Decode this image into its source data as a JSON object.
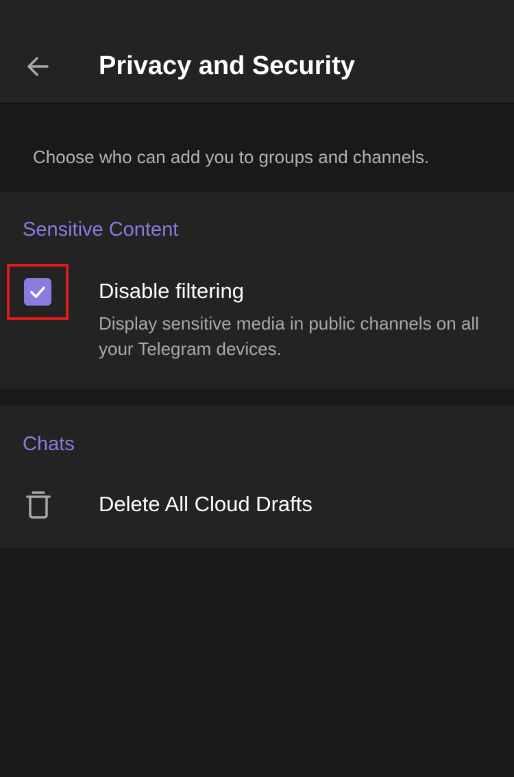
{
  "header": {
    "back_icon": "arrow-left-icon",
    "title": "Privacy and Security"
  },
  "info": {
    "text": "Choose who can add you to groups and channels."
  },
  "sensitive_content": {
    "header": "Sensitive Content",
    "disable_filtering": {
      "title": "Disable filtering",
      "subtitle": "Display sensitive media in public channels on all your Telegram devices.",
      "checked": true,
      "icon": "checkbox-icon"
    }
  },
  "chats": {
    "header": "Chats",
    "delete_drafts": {
      "title": "Delete All Cloud Drafts",
      "icon": "trash-icon"
    }
  },
  "colors": {
    "accent": "#8b7bde",
    "background": "#1b1b1b",
    "surface": "#232323",
    "highlight": "#e11a1a"
  }
}
